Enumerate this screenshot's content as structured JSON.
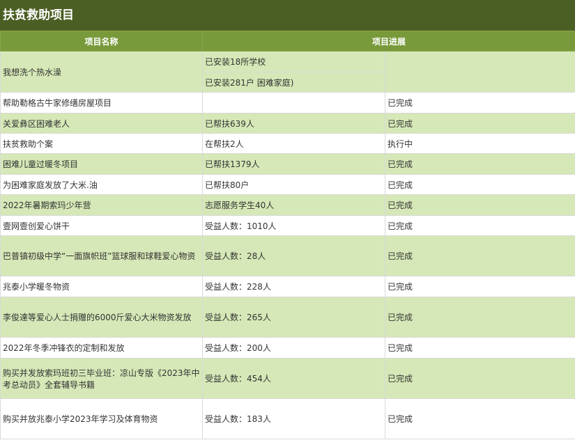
{
  "title": "扶贫救助项目",
  "columns": {
    "name": "项目名称",
    "progress": "项目进展"
  },
  "first_row": {
    "name": "我想洗个热水澡",
    "sub1": "已安装18所学校",
    "sub2": "已安装281户 困难家庭)",
    "status": ""
  },
  "rows": [
    {
      "name": "帮助勒格古牛家修缮房屋项目",
      "progress": "",
      "status": "已完成"
    },
    {
      "name": "关爱彝区困难老人",
      "progress": "已帮扶639人",
      "status": "已完成"
    },
    {
      "name": "扶贫救助个案",
      "progress": "在帮扶2人",
      "status": "执行中"
    },
    {
      "name": "困难儿童过暖冬项目",
      "progress": "已帮扶1379人",
      "status": "已完成"
    },
    {
      "name": "为困难家庭发放了大米.油",
      "progress": "已帮扶80户",
      "status": "已完成"
    },
    {
      "name": "2022年暑期索玛少年营",
      "progress": "志愿服务学生40人",
      "status": "已完成"
    },
    {
      "name": "壹网壹创爱心饼干",
      "progress": "受益人数：1010人",
      "status": "已完成"
    },
    {
      "name": "巴普镇初级中学“一面旗帜班”篮球服和球鞋爱心物资",
      "progress": "受益人数：28人",
      "status": "已完成"
    },
    {
      "name": "兆泰小学暖冬物资",
      "progress": "受益人数：228人",
      "status": "已完成"
    },
    {
      "name": "李俊達等爱心人士捐赠的6000斤爱心大米物资发放",
      "progress": "受益人数：265人",
      "status": "已完成"
    },
    {
      "name": "2022年冬季冲锋衣的定制和发放",
      "progress": "受益人数：200人",
      "status": "已完成"
    },
    {
      "name": "购买并发放索玛班初三毕业班：凉山专版《2023年中考总动员》全套辅导书籍",
      "progress": "受益人数：454人",
      "status": "已完成"
    },
    {
      "name": "购买并放兆泰小学2023年学习及体育物资",
      "progress": "受益人数：183人",
      "status": "已完成"
    }
  ]
}
